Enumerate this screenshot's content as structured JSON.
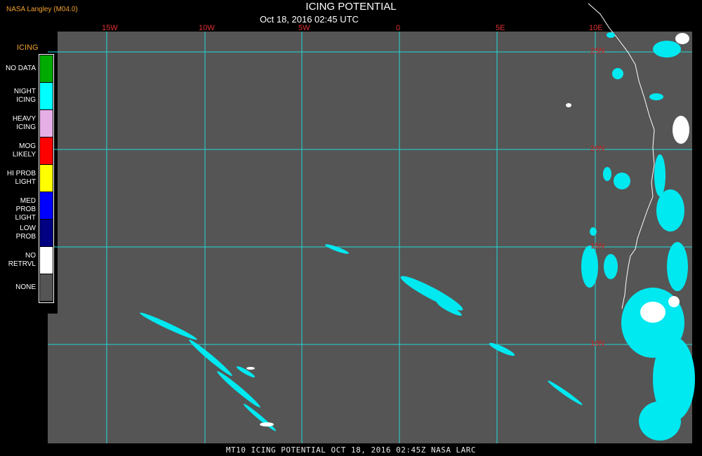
{
  "header": {
    "title": "ICING POTENTIAL",
    "subtitle": "Oct 18, 2016 02:45 UTC",
    "org": "NASA Langley (M04.0)"
  },
  "map": {
    "lon_labels": [
      "15W",
      "10W",
      "5W",
      "0",
      "5E",
      "10E"
    ],
    "lat_labels": [
      "25N",
      "20N",
      "15N",
      "10N"
    ],
    "colors": {
      "background": "#555555",
      "grid": "#22d8d8",
      "coast": "#ffffff",
      "night_icing": "#00ffff",
      "no_retrieval": "#ffffff"
    }
  },
  "legend": {
    "title": "ICING",
    "items": [
      {
        "label1": "NO DATA",
        "label2": "",
        "color": "#00aa00"
      },
      {
        "label1": "NIGHT",
        "label2": "ICING",
        "color": "#00ffff"
      },
      {
        "label1": "HEAVY",
        "label2": "ICING",
        "color": "#e6b0e6"
      },
      {
        "label1": "MOG",
        "label2": "LIKELY",
        "color": "#ff0000"
      },
      {
        "label1": "HI PROB",
        "label2": "LIGHT",
        "color": "#ffff00"
      },
      {
        "label1": "MED PROB",
        "label2": "LIGHT",
        "color": "#0000ff"
      },
      {
        "label1": "LOW",
        "label2": "PROB",
        "color": "#000080"
      },
      {
        "label1": "NO",
        "label2": "RETRVL",
        "color": "#ffffff"
      },
      {
        "label1": "NONE",
        "label2": "",
        "color": "#555555"
      }
    ]
  },
  "footer": "MT10  ICING POTENTIAL  OCT 18, 2016 02:45Z  NASA LARC"
}
